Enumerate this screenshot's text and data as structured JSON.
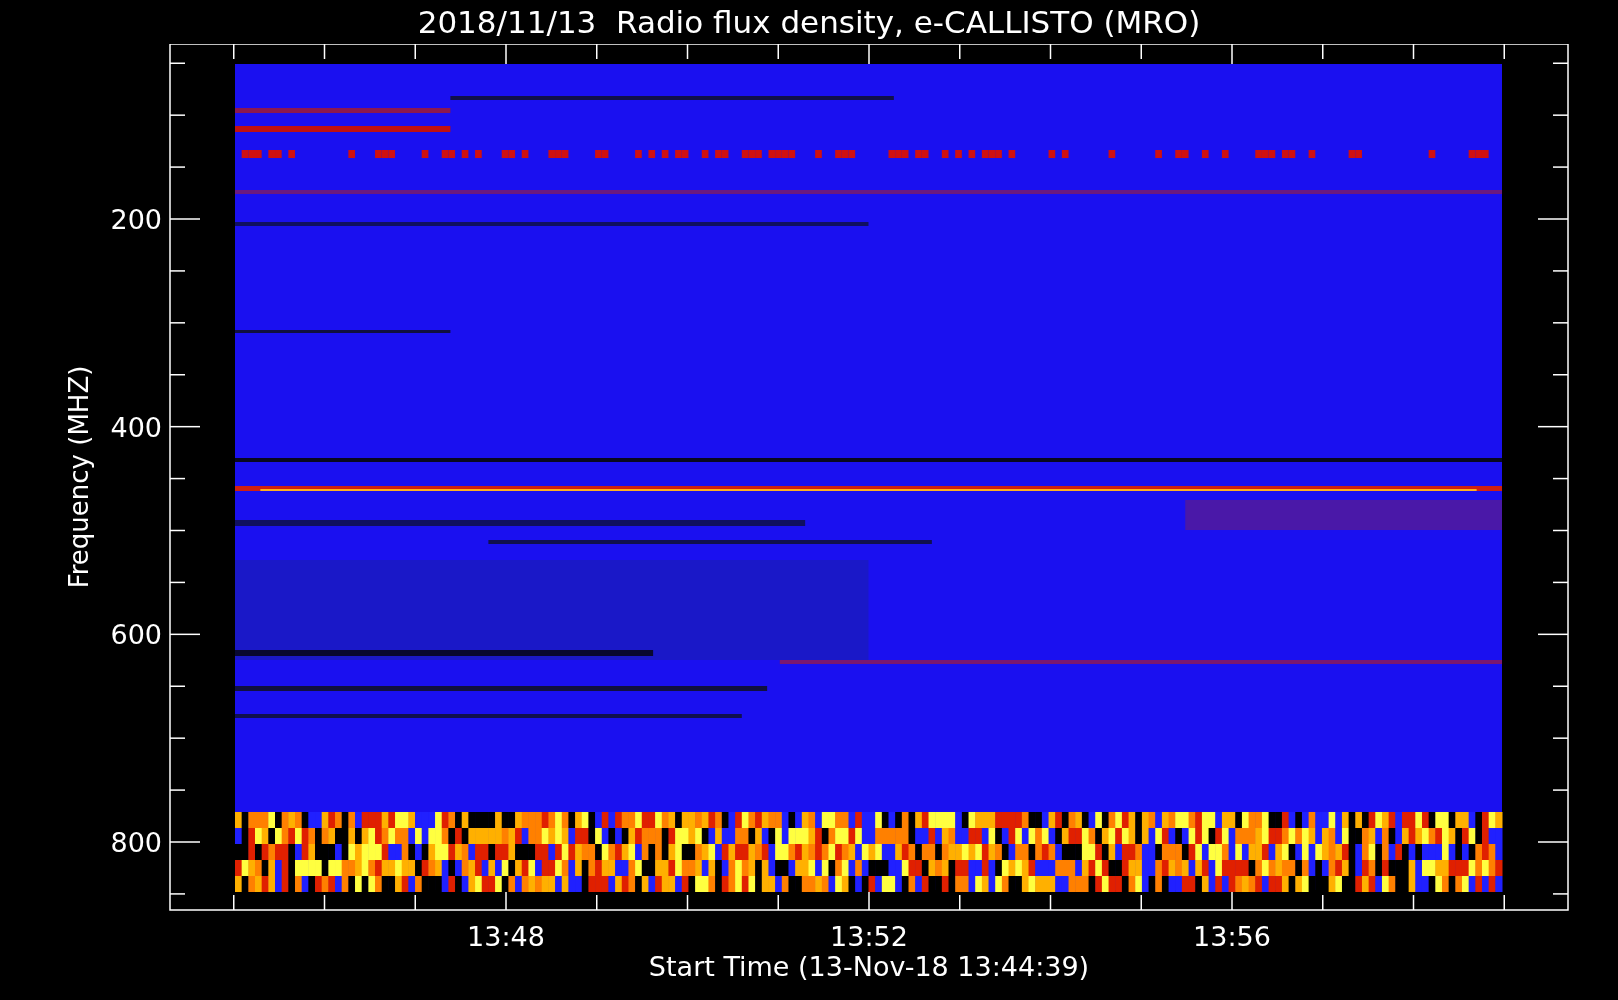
{
  "title": "2018/11/13  Radio flux density, e-CALLISTO (MRO)",
  "y_axis": {
    "label": "Frequency (MHZ)",
    "ticks": [
      "200",
      "400",
      "600",
      "800"
    ]
  },
  "x_axis": {
    "label": "Start Time (13-Nov-18 13:44:39)",
    "ticks": [
      "13:48",
      "13:52",
      "13:56"
    ]
  }
}
